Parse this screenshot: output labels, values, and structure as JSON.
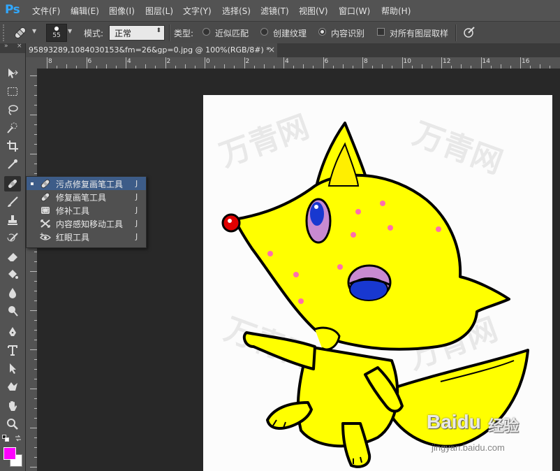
{
  "app": {
    "logo": "Ps"
  },
  "menu": [
    "文件(F)",
    "编辑(E)",
    "图像(I)",
    "图层(L)",
    "文字(Y)",
    "选择(S)",
    "滤镜(T)",
    "视图(V)",
    "窗口(W)",
    "帮助(H)"
  ],
  "options": {
    "brush_size": "55",
    "mode_label": "模式:",
    "mode_value": "正常",
    "type_label": "类型:",
    "type_options": [
      "近似匹配",
      "创建纹理",
      "内容识别"
    ],
    "selected_type": "内容识别",
    "sample_all_layers": "对所有图层取样"
  },
  "document": {
    "tab_title": "95893289,1084030153&fm=26&gp=0.jpg @ 100%(RGB/8#) *",
    "close": "×"
  },
  "ruler": {
    "labels": [
      "8",
      "6",
      "4",
      "2",
      "0",
      "2",
      "4",
      "6",
      "8",
      "10",
      "12",
      "14",
      "16"
    ]
  },
  "flyout": {
    "items": [
      {
        "label": "污点修复画笔工具",
        "key": "J",
        "icon": "spot-healing-icon"
      },
      {
        "label": "修复画笔工具",
        "key": "J",
        "icon": "healing-brush-icon"
      },
      {
        "label": "修补工具",
        "key": "J",
        "icon": "patch-icon"
      },
      {
        "label": "内容感知移动工具",
        "key": "J",
        "icon": "content-aware-move-icon"
      },
      {
        "label": "红眼工具",
        "key": "J",
        "icon": "red-eye-icon"
      }
    ]
  },
  "colors": {
    "foreground": "#ff00ff",
    "background": "#ffffff",
    "accent": "#31a8ff",
    "fox": "#ffff00"
  },
  "image": {
    "watermark": "万青网",
    "baidu_logo": "Baidu",
    "baidu_suffix": "经验",
    "baidu_url": "jingyan.baidu.com"
  }
}
